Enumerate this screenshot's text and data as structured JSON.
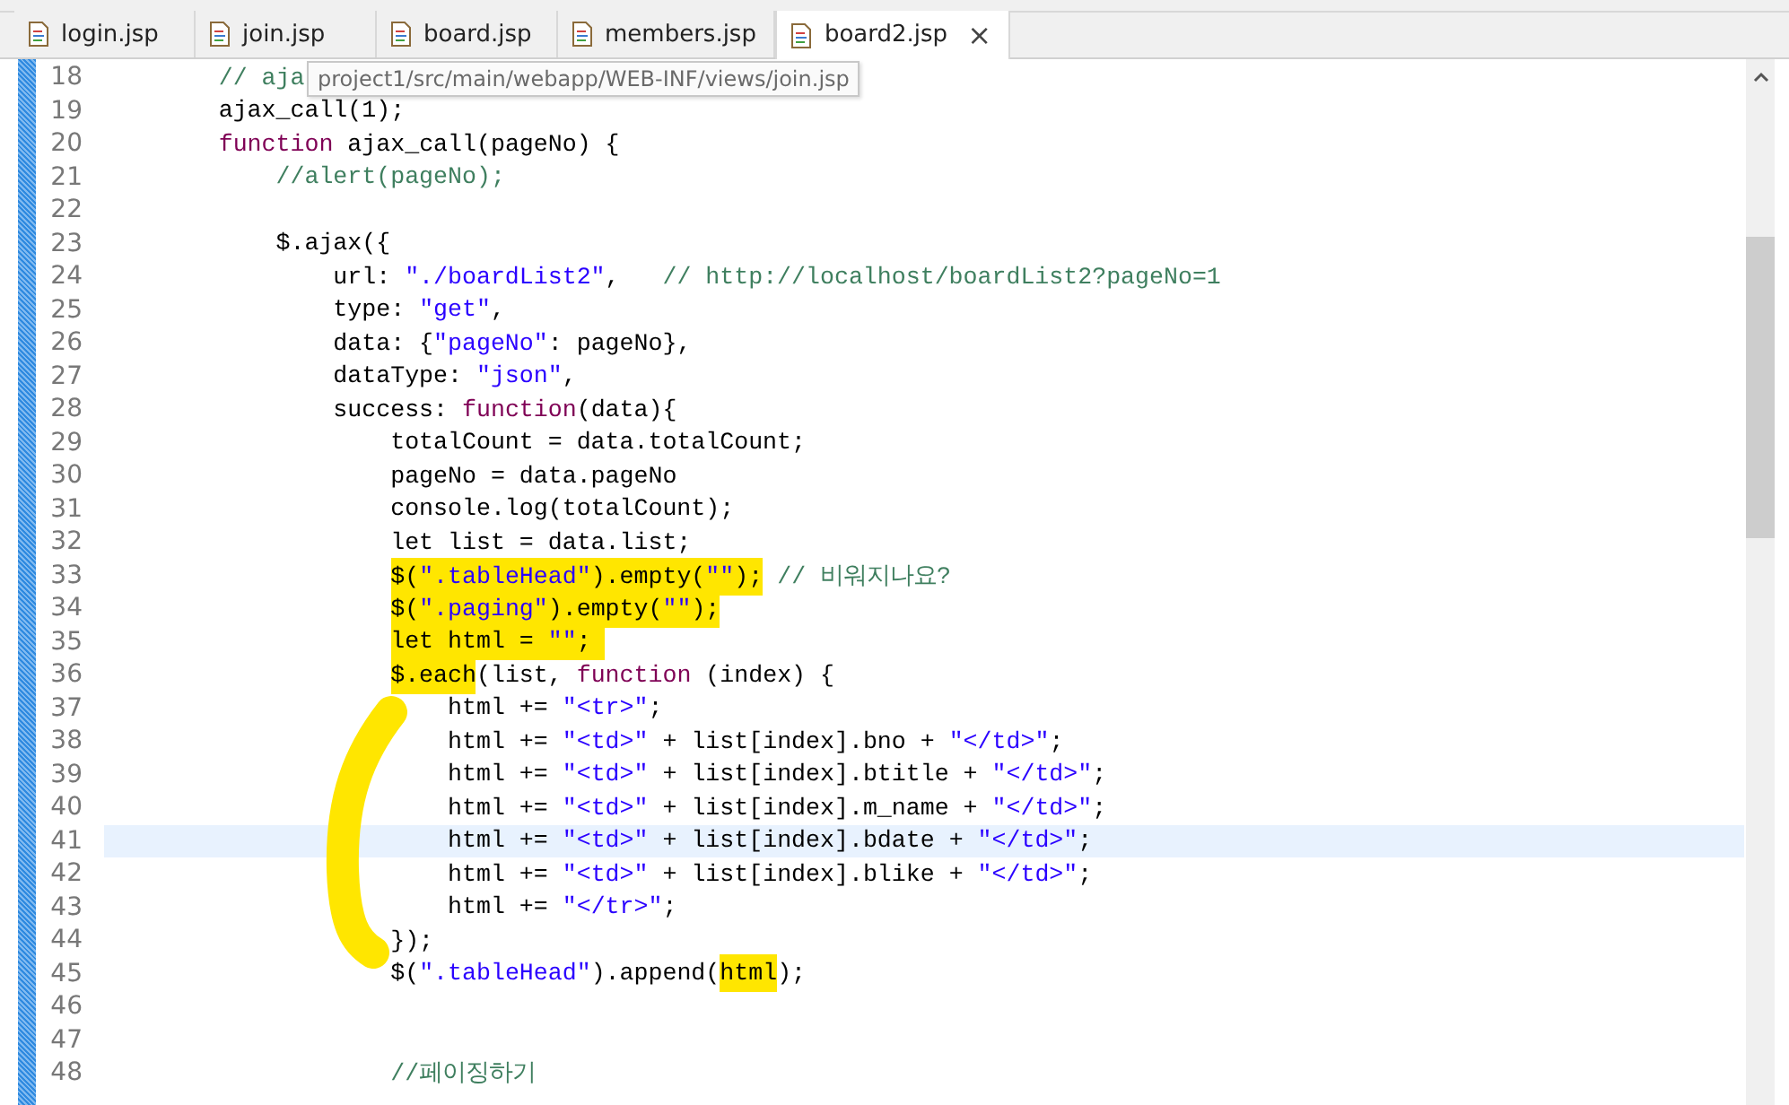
{
  "tabs": [
    {
      "label": "login.jsp",
      "selected": false
    },
    {
      "label": "join.jsp",
      "selected": false
    },
    {
      "label": "board.jsp",
      "selected": false
    },
    {
      "label": "members.jsp",
      "selected": false
    },
    {
      "label": "board2.jsp",
      "selected": true,
      "close": "×"
    }
  ],
  "tooltip": "project1/src/main/webapp/WEB-INF/views/join.jsp",
  "lines": [
    {
      "no": "18",
      "current": false,
      "segs": [
        {
          "kind": "comment",
          "text": "\t\t// aja"
        }
      ]
    },
    {
      "no": "19",
      "current": false,
      "segs": [
        {
          "kind": "plain",
          "text": "\t\tajax_call(1);"
        }
      ]
    },
    {
      "no": "20",
      "current": false,
      "segs": [
        {
          "kind": "keyword",
          "text": "\t\tfunction"
        },
        {
          "kind": "plain",
          "text": " ajax_call(pageNo) {"
        }
      ]
    },
    {
      "no": "21",
      "current": false,
      "segs": [
        {
          "kind": "comment",
          "text": "\t\t\t//alert(pageNo);"
        }
      ]
    },
    {
      "no": "22",
      "current": false
    },
    {
      "no": "23",
      "current": false,
      "segs": [
        {
          "kind": "plain",
          "text": "\t\t\t$.ajax({"
        }
      ]
    },
    {
      "no": "24",
      "current": false,
      "segs": [
        {
          "kind": "plain",
          "text": "\t\t\t\turl: "
        },
        {
          "kind": "string",
          "text": "\"./boardList2\""
        },
        {
          "kind": "plain",
          "text": ",   "
        },
        {
          "kind": "comment",
          "text": "// http://localhost/boardList2?pageNo=1"
        }
      ]
    },
    {
      "no": "25",
      "current": false,
      "segs": [
        {
          "kind": "plain",
          "text": "\t\t\t\ttype: "
        },
        {
          "kind": "string",
          "text": "\"get\""
        },
        {
          "kind": "plain",
          "text": ","
        }
      ]
    },
    {
      "no": "26",
      "current": false,
      "segs": [
        {
          "kind": "plain",
          "text": "\t\t\t\tdata: {"
        },
        {
          "kind": "string",
          "text": "\"pageNo\""
        },
        {
          "kind": "plain",
          "text": ": pageNo},"
        }
      ]
    },
    {
      "no": "27",
      "current": false,
      "segs": [
        {
          "kind": "plain",
          "text": "\t\t\t\tdataType: "
        },
        {
          "kind": "string",
          "text": "\"json\""
        },
        {
          "kind": "plain",
          "text": ","
        }
      ]
    },
    {
      "no": "28",
      "current": false,
      "segs": [
        {
          "kind": "plain",
          "text": "\t\t\t\tsuccess: "
        },
        {
          "kind": "keyword",
          "text": "function"
        },
        {
          "kind": "plain",
          "text": "(data){"
        }
      ]
    },
    {
      "no": "29",
      "current": false,
      "segs": [
        {
          "kind": "plain",
          "text": "\t\t\t\t\ttotalCount = data.totalCount;"
        }
      ]
    },
    {
      "no": "30",
      "current": false,
      "segs": [
        {
          "kind": "plain",
          "text": "\t\t\t\t\tpageNo = data.pageNo"
        }
      ]
    },
    {
      "no": "31",
      "current": false,
      "segs": [
        {
          "kind": "plain",
          "text": "\t\t\t\t\tconsole.log(totalCount);"
        }
      ]
    },
    {
      "no": "32",
      "current": false,
      "segs": [
        {
          "kind": "plain",
          "text": "\t\t\t\t\tlet list = data.list;"
        }
      ]
    },
    {
      "no": "33",
      "current": false,
      "segs": [
        {
          "kind": "plain",
          "text": "\t\t\t\t\t$(",
          "marked": true
        },
        {
          "kind": "string",
          "text": "\".tableHead\"",
          "marked": true
        },
        {
          "kind": "plain",
          "text": ").empty(",
          "marked": true
        },
        {
          "kind": "string",
          "text": "\"\"",
          "marked": true
        },
        {
          "kind": "plain",
          "text": ");",
          "marked": true
        },
        {
          "kind": "comment",
          "text": " // 비워지나요?"
        }
      ]
    },
    {
      "no": "34",
      "current": false,
      "segs": [
        {
          "kind": "plain",
          "text": "\t\t\t\t\t$(",
          "marked": true
        },
        {
          "kind": "string",
          "text": "\".paging\"",
          "marked": true
        },
        {
          "kind": "plain",
          "text": ").empty(",
          "marked": true
        },
        {
          "kind": "string",
          "text": "\"\"",
          "marked": true
        },
        {
          "kind": "plain",
          "text": ");",
          "marked": true
        }
      ]
    },
    {
      "no": "35",
      "current": false,
      "segs": [
        {
          "kind": "plain",
          "text": "\t\t\t\t\tlet html = ",
          "marked": true
        },
        {
          "kind": "string",
          "text": "\"\"",
          "marked": true
        },
        {
          "kind": "plain",
          "text": "; ",
          "marked": true
        }
      ]
    },
    {
      "no": "36",
      "current": false,
      "segs": [
        {
          "kind": "plain",
          "text": "\t\t\t\t\t$.each",
          "marked": true
        },
        {
          "kind": "plain",
          "text": "(list, "
        },
        {
          "kind": "keyword",
          "text": "function"
        },
        {
          "kind": "plain",
          "text": " (index) {"
        }
      ]
    },
    {
      "no": "37",
      "current": false,
      "segs": [
        {
          "kind": "plain",
          "text": "\t\t\t\t\t\thtml += "
        },
        {
          "kind": "string",
          "text": "\"<tr>\""
        },
        {
          "kind": "plain",
          "text": ";"
        }
      ]
    },
    {
      "no": "38",
      "current": false,
      "segs": [
        {
          "kind": "plain",
          "text": "\t\t\t\t\t\thtml += "
        },
        {
          "kind": "string",
          "text": "\"<td>\""
        },
        {
          "kind": "plain",
          "text": " + list[index].bno + "
        },
        {
          "kind": "string",
          "text": "\"</td>\""
        },
        {
          "kind": "plain",
          "text": ";"
        }
      ]
    },
    {
      "no": "39",
      "current": false,
      "segs": [
        {
          "kind": "plain",
          "text": "\t\t\t\t\t\thtml += "
        },
        {
          "kind": "string",
          "text": "\"<td>\""
        },
        {
          "kind": "plain",
          "text": " + list[index].btitle + "
        },
        {
          "kind": "string",
          "text": "\"</td>\""
        },
        {
          "kind": "plain",
          "text": ";"
        }
      ]
    },
    {
      "no": "40",
      "current": false,
      "segs": [
        {
          "kind": "plain",
          "text": "\t\t\t\t\t\thtml += "
        },
        {
          "kind": "string",
          "text": "\"<td>\""
        },
        {
          "kind": "plain",
          "text": " + list[index].m_name + "
        },
        {
          "kind": "string",
          "text": "\"</td>\""
        },
        {
          "kind": "plain",
          "text": ";"
        }
      ]
    },
    {
      "no": "41",
      "current": true,
      "segs": [
        {
          "kind": "plain",
          "text": "\t\t\t\t\t\thtml += "
        },
        {
          "kind": "string",
          "text": "\"<td>\""
        },
        {
          "kind": "plain",
          "text": " + list[index].bdate + "
        },
        {
          "kind": "string",
          "text": "\"</td>\""
        },
        {
          "kind": "plain",
          "text": ";"
        }
      ]
    },
    {
      "no": "42",
      "current": false,
      "segs": [
        {
          "kind": "plain",
          "text": "\t\t\t\t\t\thtml += "
        },
        {
          "kind": "string",
          "text": "\"<td>\""
        },
        {
          "kind": "plain",
          "text": " + list[index].blike + "
        },
        {
          "kind": "string",
          "text": "\"</td>\""
        },
        {
          "kind": "plain",
          "text": ";"
        }
      ]
    },
    {
      "no": "43",
      "current": false,
      "segs": [
        {
          "kind": "plain",
          "text": "\t\t\t\t\t\thtml += "
        },
        {
          "kind": "string",
          "text": "\"</tr>\""
        },
        {
          "kind": "plain",
          "text": ";"
        }
      ]
    },
    {
      "no": "44",
      "current": false,
      "segs": [
        {
          "kind": "plain",
          "text": "\t\t\t\t\t});"
        }
      ]
    },
    {
      "no": "45",
      "current": false,
      "segs": [
        {
          "kind": "plain",
          "text": "\t\t\t\t\t$("
        },
        {
          "kind": "string",
          "text": "\".tableHead\""
        },
        {
          "kind": "plain",
          "text": ").append("
        },
        {
          "kind": "plain",
          "text": "html",
          "marked": true
        },
        {
          "kind": "plain",
          "text": ");"
        }
      ]
    },
    {
      "no": "46",
      "current": false
    },
    {
      "no": "47",
      "current": false
    },
    {
      "no": "48",
      "current": false,
      "segs": [
        {
          "kind": "comment",
          "text": "\t\t\t\t\t//페이징하기"
        }
      ]
    }
  ]
}
